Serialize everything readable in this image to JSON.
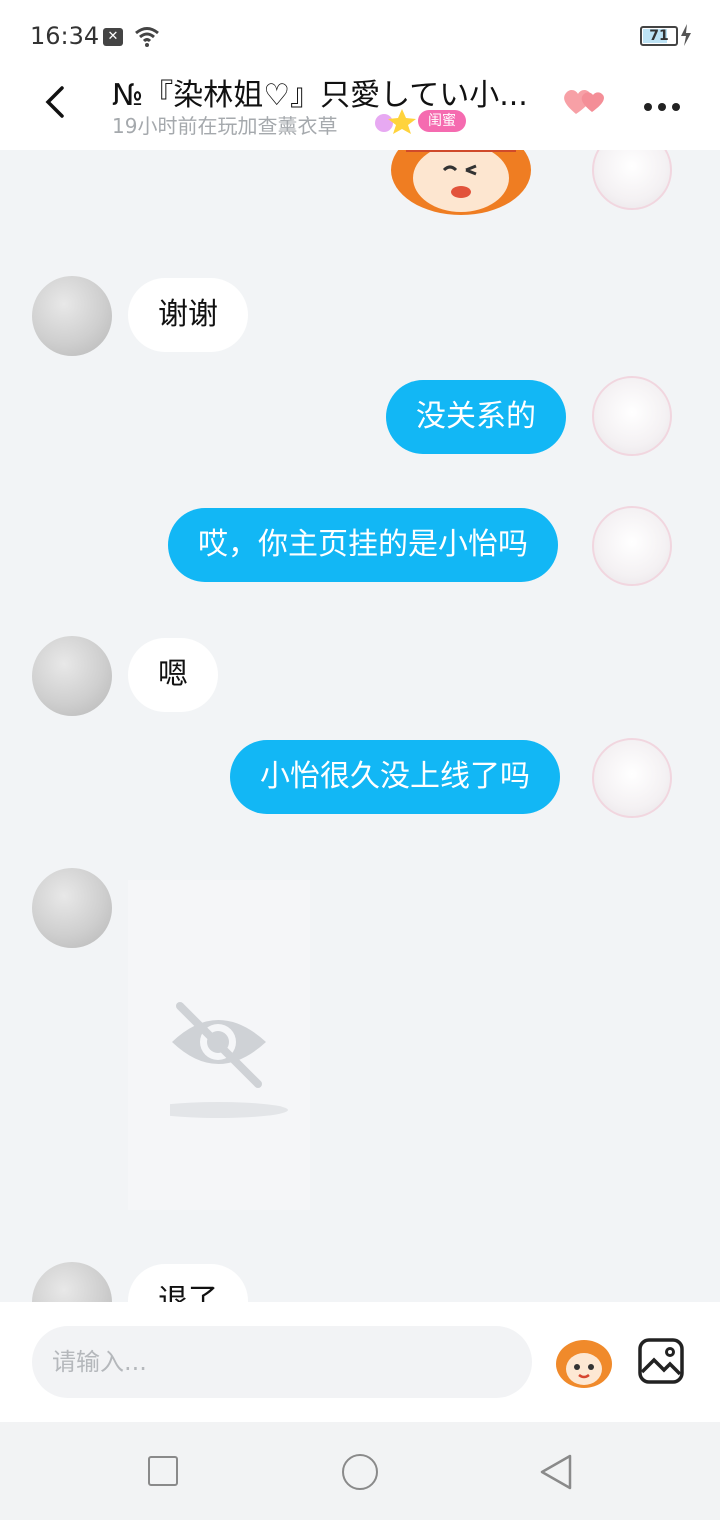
{
  "status_bar": {
    "time": "16:34",
    "battery": "71"
  },
  "header": {
    "title": "№『染林姐♡』只愛してい小...",
    "subtitle": "19小时前在玩加查薰衣草",
    "relation_badge": "闺蜜"
  },
  "messages": [
    {
      "side": "in",
      "text": "谢谢"
    },
    {
      "side": "out",
      "text": "没关系的"
    },
    {
      "side": "out",
      "text": "哎，你主页挂的是小怡吗"
    },
    {
      "side": "in",
      "text": "嗯"
    },
    {
      "side": "out",
      "text": "小怡很久没上线了吗"
    },
    {
      "side": "in",
      "text": ""
    },
    {
      "side": "in",
      "text": "退了"
    }
  ],
  "input": {
    "placeholder": "请输入..."
  },
  "colors": {
    "accent": "#12b7f5",
    "badge": "#f56bb0"
  }
}
